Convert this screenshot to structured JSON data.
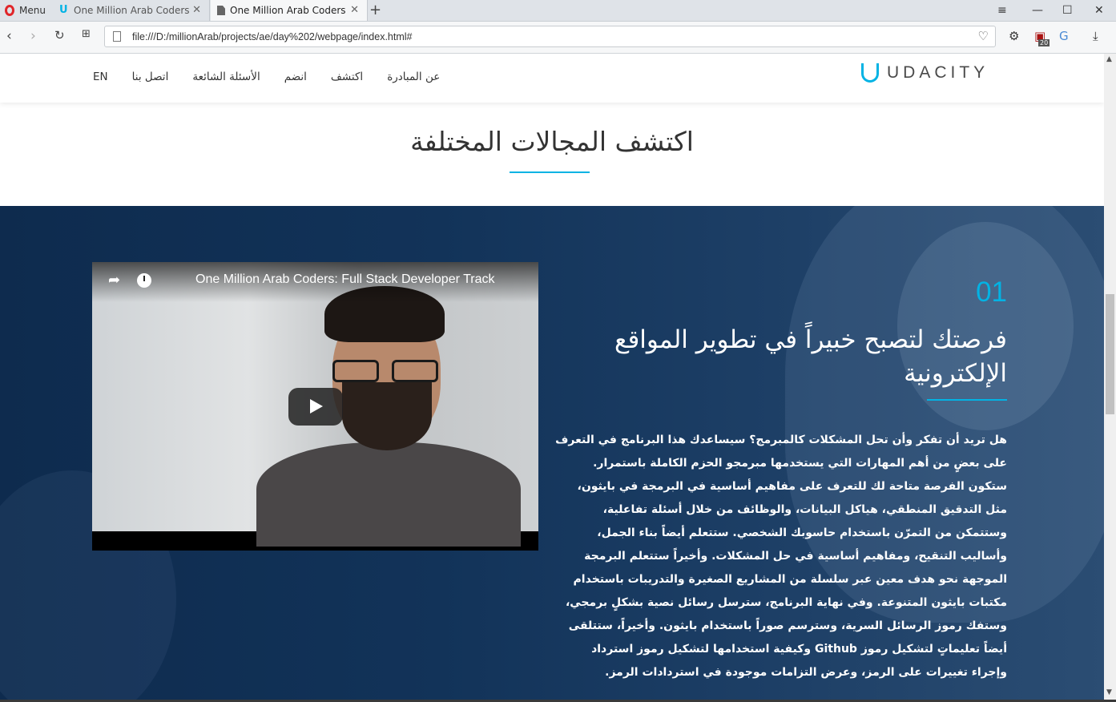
{
  "browser": {
    "menu_label": "Menu",
    "tabs": [
      {
        "title": "One Million Arab Coders",
        "close": "✕"
      },
      {
        "title": "One Million Arab Coders",
        "close": "✕"
      }
    ],
    "new_tab": "+",
    "url": "file:///D:/millionArab/projects/ae/day%202/webpage/index.html#",
    "extension_badge": "20"
  },
  "site": {
    "logo_text": "UDACITY",
    "nav": [
      "EN",
      "اتصل بنا",
      "الأسئلة الشائعة",
      "انضم",
      "اكتشف",
      "عن المبادرة"
    ],
    "section_title": "اكتشف المجالات المختلفة"
  },
  "video": {
    "title": "One Million Arab Coders: Full Stack Developer Track"
  },
  "track": {
    "number": "01",
    "heading": "فرصتك لتصبح خبيراً في تطوير المواقع الإلكترونية",
    "description": "هل تريد أن تفكر وأن تحل المشكلات كالمبرمج؟ سيساعدك هذا البرنامج في التعرف على بعضٍ من أهم المهارات التي يستخدمها مبرمجو الحزم الكاملة باستمرار. ستكون الفرصة متاحة لك للتعرف على مفاهيم أساسية في البرمجة في بايثون، مثل التدقيق المنطقي، هياكل البيانات، والوظائف من خلال أسئلة تفاعلية، وستتمكن من التمرّن باستخدام حاسوبك الشخصي. ستتعلم أيضاً بناء الجمل، وأساليب التنقيح، ومفاهيم أساسية في حل المشكلات. وأخيراً ستتعلم البرمجة الموجهة نحو هدف معين عبر سلسلة من المشاريع الصغيرة والتدريبات باستخدام مكتبات بايثون المتنوعة. وفي نهاية البرنامج، سترسل رسائل نصية بشكلٍ برمجي، وستفك رموز الرسائل السرية، وسترسم صوراً باستخدام بايثون. وأخيراً، ستتلقى أيضاً تعليماتٍ لتشكيل رموز Github وكيفية استخدامها لتشكيل رموز استرداد وإجراء تغييرات على الرمز، وعرض التزامات موجودة في استردادات الرمز."
  },
  "colors": {
    "accent": "#02b3e4",
    "dark_bg": "#123359"
  }
}
